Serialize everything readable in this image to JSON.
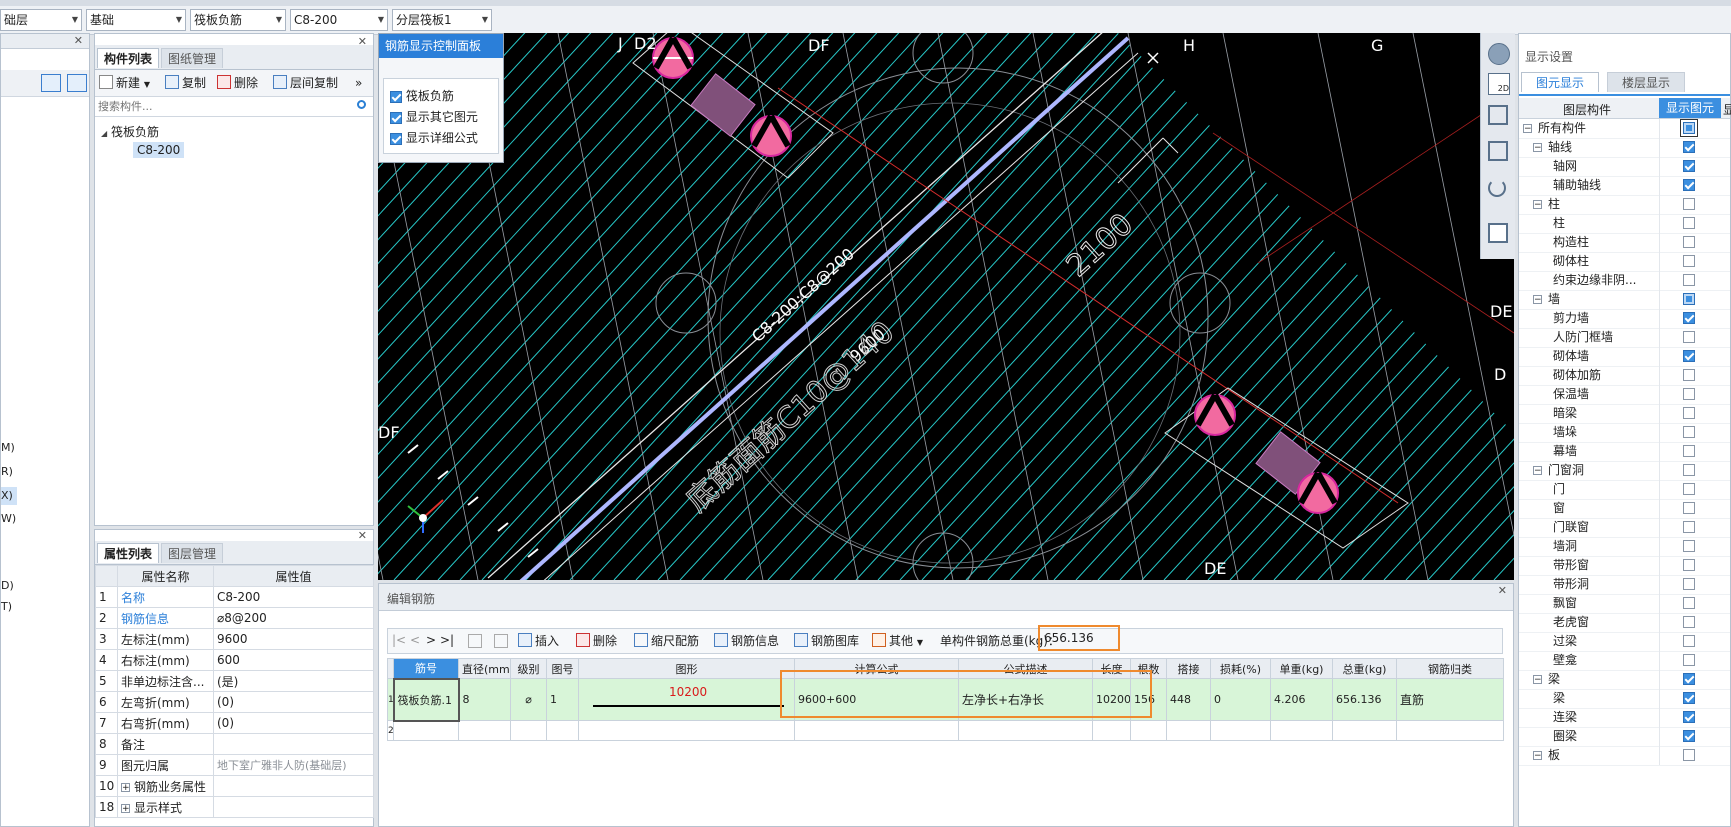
{
  "toolbar": {
    "selectors": [
      "础层",
      "基础",
      "筏板负筋",
      "C8-200",
      "分层筏板1"
    ]
  },
  "left_edge": {
    "labels": [
      "M)",
      "R)",
      "X)",
      "W)",
      "D)",
      "T)"
    ]
  },
  "component_panel": {
    "tabs": [
      "构件列表",
      "图纸管理"
    ],
    "buttons": {
      "new": "新建",
      "copy": "复制",
      "delete": "删除",
      "layer_copy": "层间复制",
      "more": "»"
    },
    "search_placeholder": "搜索构件...",
    "tree": {
      "group": "筏板负筋",
      "item": "C8-200"
    }
  },
  "property_panel": {
    "tabs": [
      "属性列表",
      "图层管理"
    ],
    "headers": [
      "属性名称",
      "属性值"
    ],
    "rows": [
      {
        "idx": "1",
        "name": "名称",
        "value": "C8-200",
        "link": true
      },
      {
        "idx": "2",
        "name": "钢筋信息",
        "value": "⌀8@200",
        "link": true
      },
      {
        "idx": "3",
        "name": "左标注(mm)",
        "value": "9600"
      },
      {
        "idx": "4",
        "name": "右标注(mm)",
        "value": "600"
      },
      {
        "idx": "5",
        "name": "非单边标注含...",
        "value": "(是)"
      },
      {
        "idx": "6",
        "name": "左弯折(mm)",
        "value": "(0)"
      },
      {
        "idx": "7",
        "name": "右弯折(mm)",
        "value": "(0)"
      },
      {
        "idx": "8",
        "name": "备注",
        "value": ""
      },
      {
        "idx": "9",
        "name": "图元归属",
        "value": "地下室广雅非人防(基础层)",
        "gray": true
      },
      {
        "idx": "10",
        "name": "钢筋业务属性",
        "value": "",
        "expand": true
      },
      {
        "idx": "18",
        "name": "显示样式",
        "value": "",
        "expand": true
      }
    ]
  },
  "control_panel": {
    "title": "钢筋显示控制面板",
    "options": [
      "筏板负筋",
      "显示其它图元",
      "显示详细公式"
    ]
  },
  "canvas": {
    "axis_labels": [
      "J",
      "D2",
      "DF",
      "H",
      "G",
      "DE",
      "D",
      "DF",
      "DE"
    ],
    "rebar_text_1": "C8-200:C8@200",
    "rebar_text_2": "9600",
    "rebar_text_3": "2100",
    "rebar_text_4": "底筋面筋C10@140"
  },
  "edit_panel": {
    "title": "编辑钢筋",
    "toolbar": {
      "insert": "插入",
      "delete": "删除",
      "scale": "缩尺配筋",
      "info": "钢筋信息",
      "library": "钢筋图库",
      "other": "其他",
      "total_label": "单构件钢筋总重(kg)：",
      "total_value": "656.136"
    },
    "headers": [
      "筋号",
      "直径(mm)",
      "级别",
      "图号",
      "图形",
      "计算公式",
      "公式描述",
      "长度",
      "根数",
      "搭接",
      "损耗(%)",
      "单重(kg)",
      "总重(kg)",
      "钢筋归类"
    ],
    "row1": {
      "idx": "1",
      "name": "筏板负筋.1",
      "dia": "8",
      "grade": "⌀",
      "fig": "1",
      "shape_len": "10200",
      "formula": "9600+600",
      "desc": "左净长+右净长",
      "length": "10200",
      "count": "156",
      "lap": "448",
      "loss": "0",
      "unit_w": "4.206",
      "total_w": "656.136",
      "category": "直筋"
    },
    "row2_idx": "2"
  },
  "display_settings": {
    "title": "显示设置",
    "tabs": [
      "图元显示",
      "楼层显示"
    ],
    "headers": [
      "图层构件",
      "显示图元",
      "显"
    ],
    "rows": [
      {
        "label": "所有构件",
        "level": 0,
        "state": "part"
      },
      {
        "label": "轴线",
        "level": 1,
        "state": "on",
        "exp": true
      },
      {
        "label": "轴网",
        "level": 2,
        "state": "on"
      },
      {
        "label": "辅助轴线",
        "level": 2,
        "state": "on"
      },
      {
        "label": "柱",
        "level": 1,
        "state": "off",
        "exp": true
      },
      {
        "label": "柱",
        "level": 2,
        "state": "off"
      },
      {
        "label": "构造柱",
        "level": 2,
        "state": "off"
      },
      {
        "label": "砌体柱",
        "level": 2,
        "state": "off"
      },
      {
        "label": "约束边缘非阴...",
        "level": 2,
        "state": "off"
      },
      {
        "label": "墙",
        "level": 1,
        "state": "part",
        "exp": true
      },
      {
        "label": "剪力墙",
        "level": 2,
        "state": "on"
      },
      {
        "label": "人防门框墙",
        "level": 2,
        "state": "off"
      },
      {
        "label": "砌体墙",
        "level": 2,
        "state": "on"
      },
      {
        "label": "砌体加筋",
        "level": 2,
        "state": "off"
      },
      {
        "label": "保温墙",
        "level": 2,
        "state": "off"
      },
      {
        "label": "暗梁",
        "level": 2,
        "state": "off"
      },
      {
        "label": "墙垛",
        "level": 2,
        "state": "off"
      },
      {
        "label": "幕墙",
        "level": 2,
        "state": "off"
      },
      {
        "label": "门窗洞",
        "level": 1,
        "state": "off",
        "exp": true
      },
      {
        "label": "门",
        "level": 2,
        "state": "off"
      },
      {
        "label": "窗",
        "level": 2,
        "state": "off"
      },
      {
        "label": "门联窗",
        "level": 2,
        "state": "off"
      },
      {
        "label": "墙洞",
        "level": 2,
        "state": "off"
      },
      {
        "label": "带形窗",
        "level": 2,
        "state": "off"
      },
      {
        "label": "带形洞",
        "level": 2,
        "state": "off"
      },
      {
        "label": "飘窗",
        "level": 2,
        "state": "off"
      },
      {
        "label": "老虎窗",
        "level": 2,
        "state": "off"
      },
      {
        "label": "过梁",
        "level": 2,
        "state": "off"
      },
      {
        "label": "壁龛",
        "level": 2,
        "state": "off"
      },
      {
        "label": "梁",
        "level": 1,
        "state": "on",
        "exp": true
      },
      {
        "label": "梁",
        "level": 2,
        "state": "on"
      },
      {
        "label": "连梁",
        "level": 2,
        "state": "on"
      },
      {
        "label": "圈梁",
        "level": 2,
        "state": "on"
      },
      {
        "label": "板",
        "level": 1,
        "state": "off",
        "exp": true
      }
    ]
  }
}
